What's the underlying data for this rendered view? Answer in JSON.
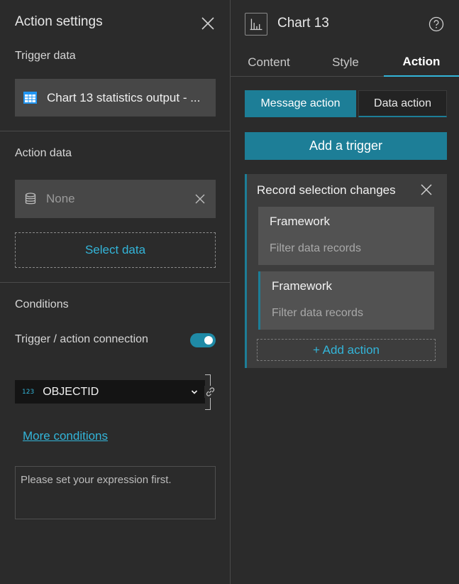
{
  "left_panel": {
    "title": "Action settings",
    "trigger_data": {
      "label": "Trigger data",
      "value": "Chart 13 statistics output - ..."
    },
    "action_data": {
      "label": "Action data",
      "value": "None",
      "select_button": "Select data"
    },
    "conditions": {
      "label": "Conditions",
      "connection_label": "Trigger / action connection",
      "connection_enabled": true,
      "field_type_badge": "123",
      "field_value": "OBJECTID",
      "more_conditions": "More conditions",
      "expression_placeholder": "Please set your expression first."
    }
  },
  "right_panel": {
    "widget_title": "Chart 13",
    "tabs": [
      {
        "label": "Content",
        "active": false
      },
      {
        "label": "Style",
        "active": false
      },
      {
        "label": "Action",
        "active": true
      }
    ],
    "segments": {
      "message_action": "Message action",
      "data_action": "Data action"
    },
    "add_trigger": "Add a trigger",
    "trigger_card": {
      "title": "Record selection changes",
      "actions": [
        {
          "name": "Framework",
          "desc": "Filter data records"
        },
        {
          "name": "Framework",
          "desc": "Filter data records"
        }
      ],
      "add_action": "+ Add action"
    }
  },
  "colors": {
    "accent": "#1d7e97",
    "link": "#33b5d9",
    "background": "#2b2b2b",
    "card": "#3d3d3d"
  }
}
